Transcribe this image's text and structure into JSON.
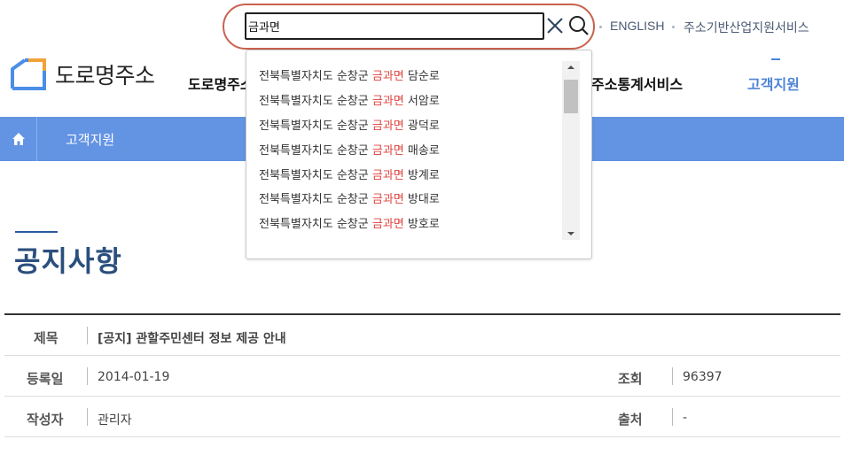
{
  "header": {
    "logo_text": "도로명주소",
    "gnb": [
      "도로명주소",
      "주소통계서비스",
      "고객지원"
    ]
  },
  "util": {
    "search_value": "금과면",
    "english": "ENGLISH",
    "service": "주소기반산업지원서비스"
  },
  "autocomplete": {
    "prefix": "전북특별자치도 순창군 ",
    "highlight": "금과면",
    "items": [
      {
        "prefix": "전북특별자치도 순창군 ",
        "hl": "금과면",
        "suffix": " 담순로"
      },
      {
        "prefix": "전북특별자치도 순창군 ",
        "hl": "금과면",
        "suffix": " 서암로"
      },
      {
        "prefix": "전북특별자치도 순창군 ",
        "hl": "금과면",
        "suffix": " 광덕로"
      },
      {
        "prefix": "전북특별자치도 순창군 ",
        "hl": "금과면",
        "suffix": " 매송로"
      },
      {
        "prefix": "전북특별자치도 순창군 ",
        "hl": "금과면",
        "suffix": " 방계로"
      },
      {
        "prefix": "전북특별자치도 순창군 ",
        "hl": "금과면",
        "suffix": " 방대로"
      },
      {
        "prefix": "전북특별자치도 순창군 ",
        "hl": "금과면",
        "suffix": " 방호로"
      }
    ]
  },
  "subbar": {
    "label": "고객지원"
  },
  "page": {
    "title": "공지사항"
  },
  "notice": {
    "title_label": "제목",
    "title_value": "[공지] 관할주민센터 정보 제공 안내",
    "date_label": "등록일",
    "date_value": "2014-01-19",
    "views_label": "조회",
    "views_value": "96397",
    "author_label": "작성자",
    "author_value": "관리자",
    "source_label": "출처",
    "source_value": "-"
  },
  "colors": {
    "accent_blue": "#6393e3",
    "title_blue": "#2b4f7d",
    "highlight_red": "#e0433f",
    "search_ring": "#c9614f"
  }
}
